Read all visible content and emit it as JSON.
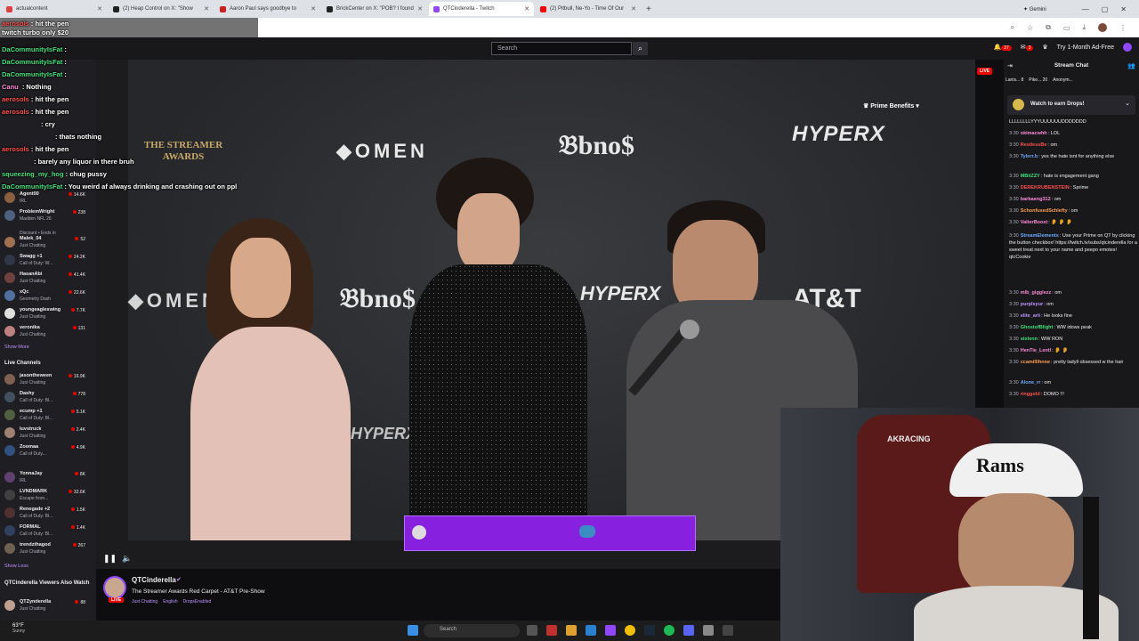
{
  "browser": {
    "tabs": [
      {
        "label": "actualcontent",
        "color": "#e04040"
      },
      {
        "label": "(2) Heap Control on X: \"Show",
        "color": "#222222"
      },
      {
        "label": "Aaron Paul says goodbye to",
        "color": "#cc2020"
      },
      {
        "label": "BrickCenter on X: \"POB? I found",
        "color": "#222222"
      },
      {
        "label": "QTCinderella - Twitch",
        "color": "#9146ff",
        "active": true
      },
      {
        "label": "(2) Pitbull, Ne-Yo - Time Of Our",
        "color": "#ff0000"
      }
    ],
    "new_tab": "+",
    "gemini": "✦ Gemini",
    "window_controls": [
      "—",
      "▢",
      "✕"
    ]
  },
  "twitch_nav": {
    "search_placeholder": "Search",
    "search_icon": "search-icon",
    "notif_count": "37",
    "whisper_count": "3",
    "ad_free": "Try 1-Month Ad-Free"
  },
  "overlay_chat": [
    {
      "user": "aerosols",
      "color": "#ff4f4f",
      "text": "hit the pen"
    },
    {
      "user": "DaCommunityIsFat",
      "color": "#3ee07a",
      "text": ""
    },
    {
      "user": "DaCommunityIsFat",
      "color": "#3ee07a",
      "text": ""
    },
    {
      "user": "DaCommunityIsFat",
      "color": "#3ee07a",
      "text": ""
    },
    {
      "user": "Canu",
      "color": "#ff8ad8",
      "text": "Nothing"
    },
    {
      "user": "aerosols",
      "color": "#ff4f4f",
      "text": "hit the pen"
    },
    {
      "user": "aerosols",
      "color": "#ff4f4f",
      "text": "hit the pen"
    },
    {
      "user": "",
      "color": "#ff4f4f",
      "text": "cry"
    },
    {
      "user": "",
      "color": "#6ea8ff",
      "text": "thats nothing"
    },
    {
      "user": "aerosols",
      "color": "#ff4f4f",
      "text": "hit the pen"
    },
    {
      "user": "",
      "color": "#ffa050",
      "text": "barely any liquor in there bruh"
    },
    {
      "user": "squeezing_my_hog",
      "color": "#3ee07a",
      "text": "chug pussy"
    },
    {
      "user": "DaCommunityIsFat",
      "color": "#3ee07a",
      "text": "You weird af always drinking and crashing out on ppl"
    }
  ],
  "overlay_top": {
    "line1": "twitch turbo only $20"
  },
  "sidebar": {
    "channels": [
      {
        "name": "Agent00",
        "game": "IRL",
        "viewers": "14.6K",
        "color": "#8a6040"
      },
      {
        "name": "ProblemWright",
        "game": "Madden NFL 26",
        "viewers": "238",
        "color": "#506080"
      },
      {
        "name": "",
        "game": "Discount • Ends in",
        "viewers": "",
        "color": "#404040"
      },
      {
        "name": "Malek_04",
        "game": "Just Chatting",
        "viewers": "52",
        "color": "#a07050"
      },
      {
        "name": "Swagg +1",
        "game": "Call of Duty: W...",
        "viewers": "24.2K",
        "color": "#303848"
      },
      {
        "name": "HasanAbi",
        "game": "Just Chatting",
        "viewers": "41.4K",
        "color": "#704040"
      },
      {
        "name": "xQc",
        "game": "Geometry Dash",
        "viewers": "22.6K",
        "color": "#5070a0"
      },
      {
        "name": "youngeagleswing",
        "game": "Just Chatting",
        "viewers": "7.7K",
        "color": "#e0e0e0"
      },
      {
        "name": "veronika",
        "game": "Just Chatting",
        "viewers": "131",
        "color": "#c08080"
      }
    ],
    "show_more": "Show More",
    "live_channels_heading": "Live Channels",
    "live_channels": [
      {
        "name": "jasontheween",
        "game": "Just Chatting",
        "viewers": "16.9K",
        "color": "#806050"
      },
      {
        "name": "Dashy",
        "game": "Call of Duty: Bl...",
        "viewers": "778",
        "color": "#405060"
      },
      {
        "name": "ecump +1",
        "game": "Call of Duty: Bl...",
        "viewers": "5.1K",
        "color": "#506040"
      },
      {
        "name": "luvstruck",
        "game": "Just Chatting",
        "viewers": "2.4K",
        "color": "#a08070"
      },
      {
        "name": "Zoomaa",
        "game": "Call of Duty...",
        "viewers": "4.9K",
        "color": "#305080"
      },
      {
        "name": "YonnaJay",
        "game": "IRL",
        "viewers": "8K",
        "color": "#604070"
      },
      {
        "name": "LVNDMARK",
        "game": "Escape from...",
        "viewers": "32.6K",
        "color": "#404040"
      },
      {
        "name": "Renegade +2",
        "game": "Call of Duty: Bl...",
        "viewers": "1.5K",
        "color": "#503030"
      },
      {
        "name": "FORMAL",
        "game": "Call of Duty: Bl...",
        "viewers": "1.4K",
        "color": "#304060"
      },
      {
        "name": "trendzthagod",
        "game": "Just Chatting",
        "viewers": "267",
        "color": "#706050"
      }
    ],
    "show_less": "Show Less",
    "viewers_also_watch": "QTCinderella Viewers Also Watch",
    "also_watch": [
      {
        "name": "QTZynderella",
        "game": "Just Chatting",
        "viewers": "88",
        "color": "#c0a090"
      }
    ]
  },
  "video": {
    "logos": [
      "◆OMEN",
      "𝔅bno$",
      "HYPERX",
      "THE STREAMER AWARDS",
      "AT&T"
    ],
    "prime_benefits": "Prime Benefits",
    "live_label": "LIVE",
    "play_icon": "pause-icon",
    "volume_icon": "volume-icon"
  },
  "stream_info": {
    "streamer": "QTCinderella",
    "title": "The Streamer Awards Red Carpet - AT&T Pre-Show",
    "tags": [
      "Just Chatting",
      "English",
      "DropsEnabled"
    ],
    "live": "LIVE"
  },
  "chat": {
    "title": "Stream Chat",
    "gifts": [
      "Lanis... 8",
      "Pike... 20",
      "Anonym..."
    ],
    "drops_text": "Watch to earn Drops!",
    "messages": [
      {
        "time": "",
        "user": "",
        "color": "#efeff1",
        "text": "LLLLLLLLYYYUUUUUUDDDDDDD"
      },
      {
        "time": "3:30",
        "user": "okimacwhh",
        "color": "#ff8ad8",
        "text": "LOL"
      },
      {
        "time": "3:30",
        "user": "RestlessBe",
        "color": "#ff4f4f",
        "text": "om"
      },
      {
        "time": "3:30",
        "user": "Tylerr.b",
        "color": "#6ea8ff",
        "text": "yes the hate isnt for anything else"
      },
      {
        "time": "3:30",
        "user": "MBiiZZY",
        "color": "#3ee07a",
        "text": "hate is engagement gang"
      },
      {
        "time": "3:30",
        "user": "DEREKRUBENSTEIN",
        "color": "#ff4f4f",
        "text": "Sprime"
      },
      {
        "time": "3:30",
        "user": "barbaeng312",
        "color": "#ff8ad8",
        "text": "om"
      },
      {
        "time": "3:30",
        "user": "SchonfusedSchlefty",
        "color": "#ffa050",
        "text": "om"
      },
      {
        "time": "3:30",
        "user": "ValterBoost",
        "color": "#ff8ad8",
        "text": "👂 👂 👂"
      },
      {
        "time": "3:30",
        "user": "StreamElements",
        "color": "#6ea8ff",
        "text": "Use your Prime on QT by clicking the button checkbox! https://twitch.tv/subs/qtcinderella for a sweet treat next to your name and peepo emotes! qtcCookie"
      },
      {
        "time": "3:30",
        "user": "mlb_gigglezz",
        "color": "#ff8ad8",
        "text": "om"
      },
      {
        "time": "3:30",
        "user": "purplsyur",
        "color": "#bf94ff",
        "text": "om"
      },
      {
        "time": "3:30",
        "user": "elite_arii",
        "color": "#bf94ff",
        "text": "He looks fine"
      },
      {
        "time": "3:30",
        "user": "GhostofBlight",
        "color": "#3ee07a",
        "text": "WW idows peak"
      },
      {
        "time": "3:30",
        "user": "stxlenn",
        "color": "#3ee07a",
        "text": "WW RON"
      },
      {
        "time": "3:30",
        "user": "HenTie_Lentl",
        "color": "#ff8ad8",
        "text": "👂 👂"
      },
      {
        "time": "3:30",
        "user": "ccamillihnne",
        "color": "#ffa050",
        "text": "pretty ladyll obsessed w the hair"
      },
      {
        "time": "3:30",
        "user": "Alone_rr",
        "color": "#6ea8ff",
        "text": "om"
      },
      {
        "time": "3:30",
        "user": "ringgold",
        "color": "#ff4f4f",
        "text": "DOMO !!!"
      }
    ]
  },
  "webcam": {
    "cap_text": "Rams",
    "chair_brand": "AKRACING"
  },
  "taskbar": {
    "temp": "63°F",
    "weather": "Sunny",
    "search": "Search"
  }
}
